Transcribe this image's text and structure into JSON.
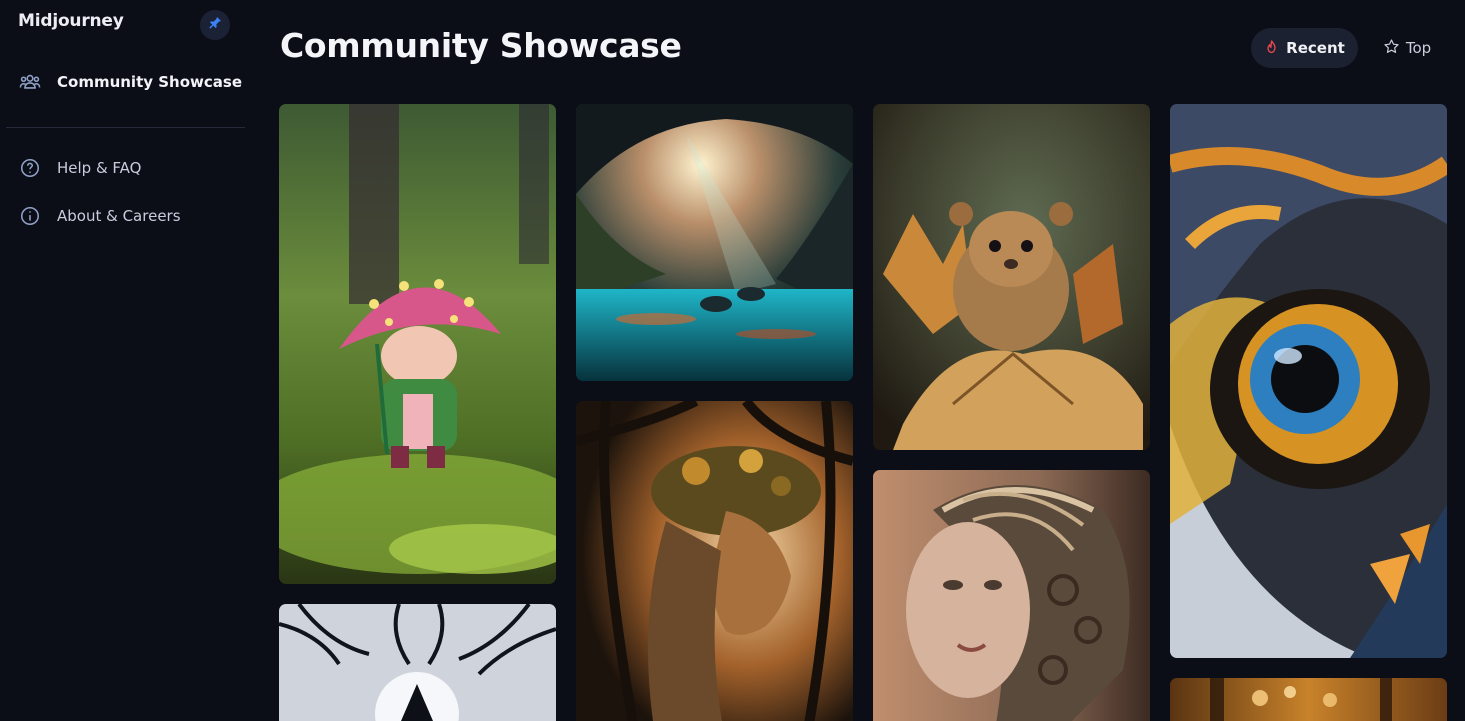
{
  "app": {
    "brand": "Midjourney"
  },
  "sidebar": {
    "items": [
      {
        "label": "Community Showcase",
        "icon": "users-icon",
        "active": true
      },
      {
        "label": "Help & FAQ",
        "icon": "help-circle-icon"
      },
      {
        "label": "About & Careers",
        "icon": "info-circle-icon"
      }
    ]
  },
  "header": {
    "title": "Community Showcase",
    "sort": [
      {
        "label": "Recent",
        "icon": "flame-icon",
        "selected": true
      },
      {
        "label": "Top",
        "icon": "star-icon",
        "selected": false
      }
    ]
  },
  "gallery": {
    "items": [
      {
        "subject": "mushroom-umbrella-figure"
      },
      {
        "subject": "tree-silhouette-house"
      },
      {
        "subject": "glowing-cave-lake"
      },
      {
        "subject": "woman-with-leaf-crown"
      },
      {
        "subject": "fluffy-lion-cub-on-leaves"
      },
      {
        "subject": "woman-with-filigree-headpiece"
      },
      {
        "subject": "bird-eye-closeup"
      },
      {
        "subject": "autumn-forest-lights"
      }
    ]
  },
  "colors": {
    "background": "#0b0d17",
    "accent_flame": "#e5484d",
    "pin": "#3b82f6",
    "button_bg": "#1c2131"
  }
}
